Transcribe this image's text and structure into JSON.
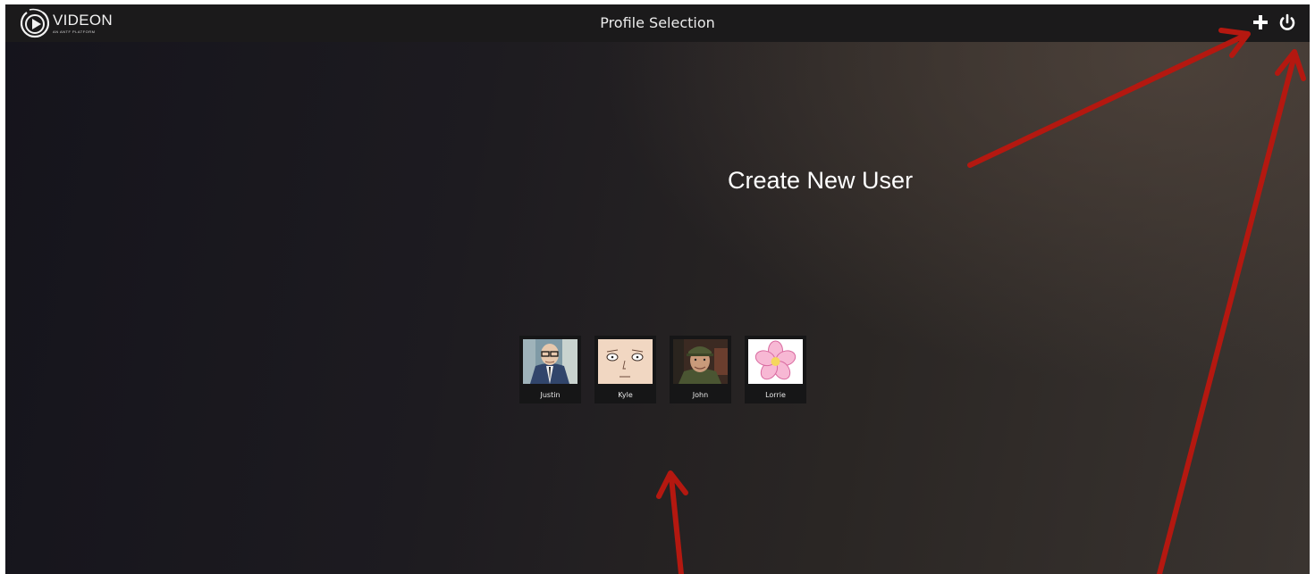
{
  "app": {
    "logo_word": "VIDEON",
    "logo_subtitle": "AN ANTF PLATFORM",
    "page_title": "Profile Selection"
  },
  "toolbar": {
    "add_icon": "plus-icon",
    "power_icon": "power-icon"
  },
  "annotation": {
    "label": "Create New User",
    "arrow_color": "#b41810"
  },
  "profiles": [
    {
      "name": "Justin",
      "avatar": "cartoon-man-glasses-suit"
    },
    {
      "name": "Kyle",
      "avatar": "cartoon-bald-face"
    },
    {
      "name": "John",
      "avatar": "soldier-photo"
    },
    {
      "name": "Lorrie",
      "avatar": "pink-flower"
    }
  ],
  "colors": {
    "topbar": "#1b1a1b",
    "background_dark": "#15141c",
    "background_warm": "#3a3430",
    "text": "#ececec"
  }
}
